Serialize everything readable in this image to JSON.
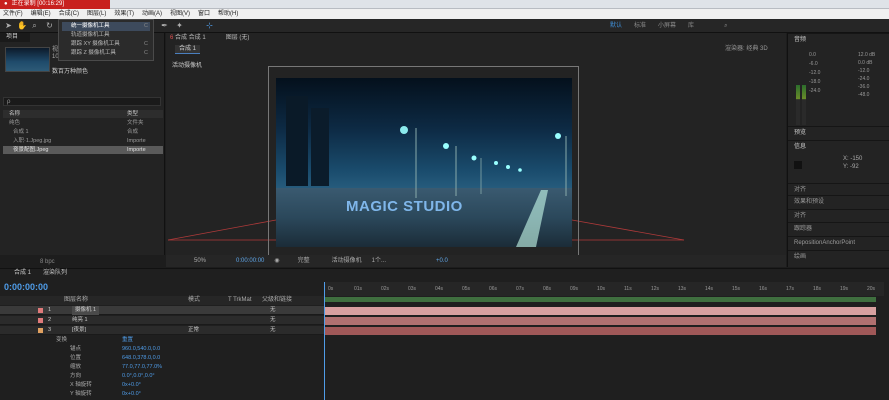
{
  "recording": {
    "status": "正在录制 [00:16:29]"
  },
  "menu": [
    "文件(F)",
    "编辑(E)",
    "合成(C)",
    "图层(L)",
    "效果(T)",
    "动画(A)",
    "视图(V)",
    "窗口",
    "帮助(H)"
  ],
  "tool_dropdown": {
    "items": [
      {
        "label": "统一摄像机工具",
        "key": "C"
      },
      {
        "label": "轨道摄像机工具",
        "key": ""
      },
      {
        "label": "跟踪 XY 摄像机工具",
        "key": "C"
      },
      {
        "label": "跟踪 Z 摄像机工具",
        "key": "C"
      }
    ]
  },
  "workspace": {
    "items": [
      "默认",
      "标准",
      "小屏幕",
      "库"
    ],
    "active": "默认"
  },
  "project": {
    "tab": "项目",
    "item_info": [
      "视觉",
      "1000 x"
    ],
    "thumb_label": "数百万种颜色",
    "search_placeholder": "ρ",
    "col_name": "名称",
    "col_type": "类型",
    "rows": [
      {
        "name": "纯色",
        "type": "文件夹"
      },
      {
        "name": "合成 1",
        "type": "合成"
      },
      {
        "name": "入职·1.Jpeg.jpg",
        "type": "Importe"
      },
      {
        "name": "夜景配图.Jpeg",
        "type": "Importe"
      }
    ],
    "bpc": "8 bpc"
  },
  "comp": {
    "tab_prefix": "6",
    "tab_label": "合成 合成 1",
    "tab2": "图层 (无)",
    "subtab": "合成 1",
    "renderer": "渲染器: 经典 3D",
    "camera_label": "活动摄像机",
    "image_text": "MAGIC STUDIO",
    "footer": {
      "zoom": "50%",
      "time": "0:00:00:00",
      "quality": "完整",
      "view": "活动摄像机",
      "views": "1个...",
      "offset": "+0.0"
    }
  },
  "right": {
    "audio": "音频",
    "db_labels": [
      "0.0",
      "-6.0",
      "-12.0",
      "-18.0",
      "-24.0"
    ],
    "db_right": [
      "12.0 dB",
      "0.0 dB",
      "-12.0",
      "-24.0",
      "-36.0",
      "-48.0"
    ],
    "preview": "预览",
    "info": "信息",
    "info_vals": [
      "X: -150",
      "Y: -92"
    ],
    "align": "对齐",
    "effects": "效果和预设",
    "align2": "对齐",
    "tracker": "跟踪器",
    "reposition": "RepositionAnchorPoint",
    "paint": "绘画"
  },
  "timeline": {
    "tab": "合成 1",
    "tab2": "渲染队列",
    "timecode": "0:00:00:00",
    "header": {
      "source": "图层名称",
      "mode": "模式",
      "trkmat": "T TrkMat",
      "parent": "父级和链接"
    },
    "ticks": [
      "0s",
      "01s",
      "02s",
      "03s",
      "04s",
      "05s",
      "06s",
      "07s",
      "08s",
      "09s",
      "10s",
      "11s",
      "12s",
      "13s",
      "14s",
      "15s",
      "16s",
      "17s",
      "18s",
      "19s",
      "20s"
    ],
    "layers": [
      {
        "num": "1",
        "name": "摄像机 1",
        "parent": "无",
        "color": "#e07a7a"
      },
      {
        "num": "2",
        "name": "纯亮 1",
        "parent": "无",
        "color": "#e07a7a"
      },
      {
        "num": "3",
        "name": "[夜景]",
        "mode": "正常",
        "parent": "无",
        "color": "#e0a060"
      }
    ],
    "transform": "变换",
    "reset": "重置",
    "props": [
      {
        "name": "锚点",
        "value": "960.0,540.0,0.0"
      },
      {
        "name": "位置",
        "value": "648.0,378.0,0.0"
      },
      {
        "name": "缩放",
        "value": "77.0,77.0,77.0%"
      },
      {
        "name": "方向",
        "value": "0.0°,0.0°,0.0°"
      },
      {
        "name": "X 轴旋转",
        "value": "0x+0.0°"
      },
      {
        "name": "Y 轴旋转",
        "value": "0x+0.0°"
      }
    ]
  }
}
